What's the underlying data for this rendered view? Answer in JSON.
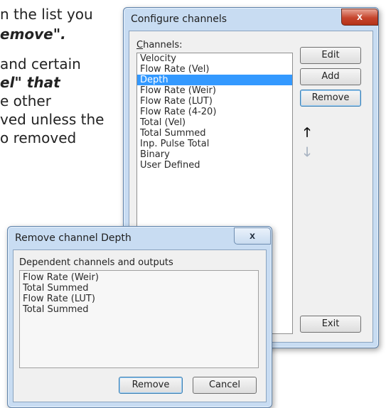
{
  "document": {
    "lines": [
      {
        "text": "n the list you"
      },
      {
        "text": "emove\".",
        "bold": true
      },
      {
        "text": "and certain"
      },
      {
        "text": "el\" that",
        "bold": true
      },
      {
        "text": "e other"
      },
      {
        "text": "ved unless the"
      },
      {
        "text": "o removed"
      }
    ]
  },
  "configure_dialog": {
    "title": "Configure channels",
    "close_label": "x",
    "channels_label": "Channels:",
    "channels": [
      "Velocity",
      "Flow Rate (Vel)",
      "Depth",
      "Flow Rate (Weir)",
      "Flow Rate (LUT)",
      "Flow Rate (4-20)",
      "Total (Vel)",
      "Total Summed",
      "Inp. Pulse Total",
      "Binary",
      "User Defined"
    ],
    "selected_index": 2,
    "buttons": {
      "edit": "Edit",
      "add": "Add",
      "remove": "Remove",
      "exit": "Exit"
    },
    "move_up_icon": "arrow-up",
    "move_down_icon": "arrow-down"
  },
  "remove_dialog": {
    "title": "Remove channel Depth",
    "close_label": "x",
    "section_label": "Dependent channels and outputs",
    "dependents": [
      "Flow Rate (Weir)",
      "Total Summed",
      "Flow Rate (LUT)",
      "Total Summed"
    ],
    "buttons": {
      "remove": "Remove",
      "cancel": "Cancel"
    }
  }
}
